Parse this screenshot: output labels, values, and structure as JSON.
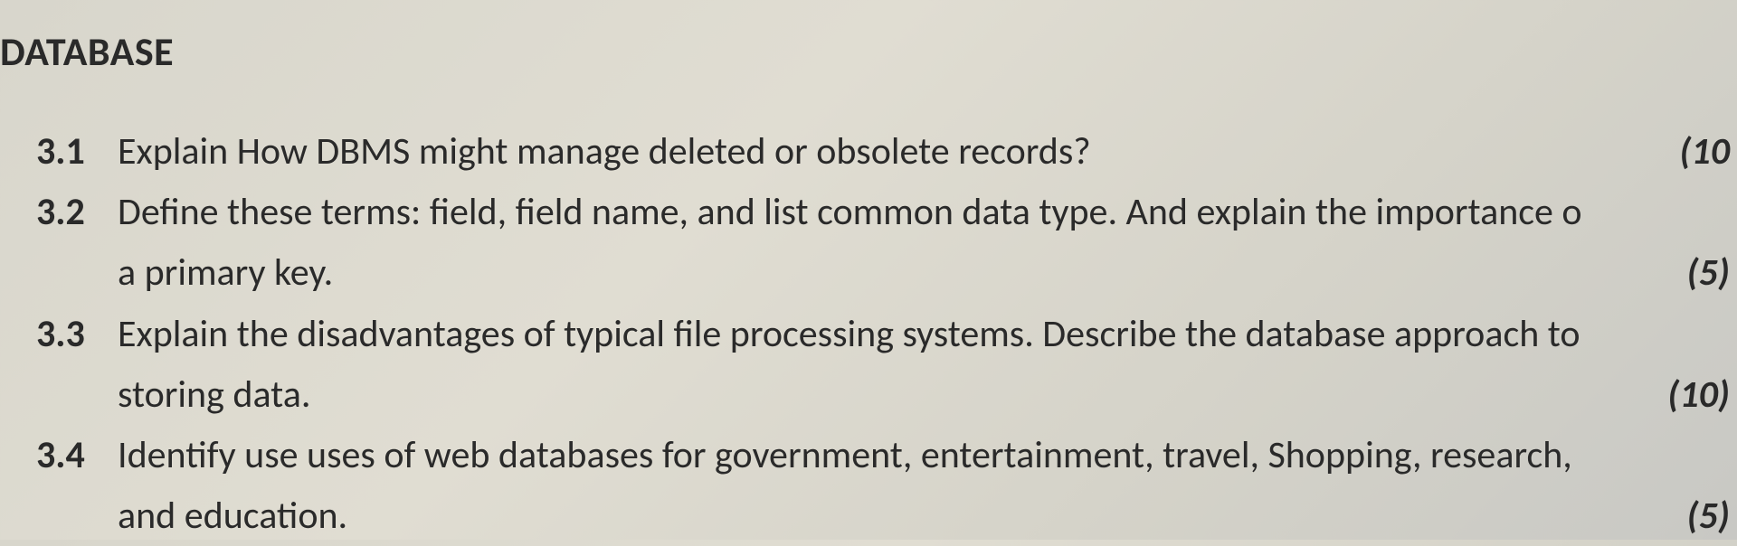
{
  "heading": "DATABASE",
  "questions": [
    {
      "num": "3.1",
      "line1": "Explain How DBMS might manage deleted or obsolete records?",
      "marks1": "(10",
      "line2": "",
      "marks2": ""
    },
    {
      "num": "3.2",
      "line1": "Define these terms: field, field name, and list common data type. And explain the importance o",
      "marks1": "",
      "line2": "a primary key.",
      "marks2": "(5)"
    },
    {
      "num": "3.3",
      "line1": "Explain the disadvantages of typical file processing systems. Describe the database approach to",
      "marks1": "",
      "line2": "storing data.",
      "marks2": "(10)"
    },
    {
      "num": "3.4",
      "line1": "Identify use uses of web databases for government, entertainment, travel, Shopping, research,",
      "marks1": "",
      "line2": "and education.",
      "marks2": "(5)"
    }
  ]
}
